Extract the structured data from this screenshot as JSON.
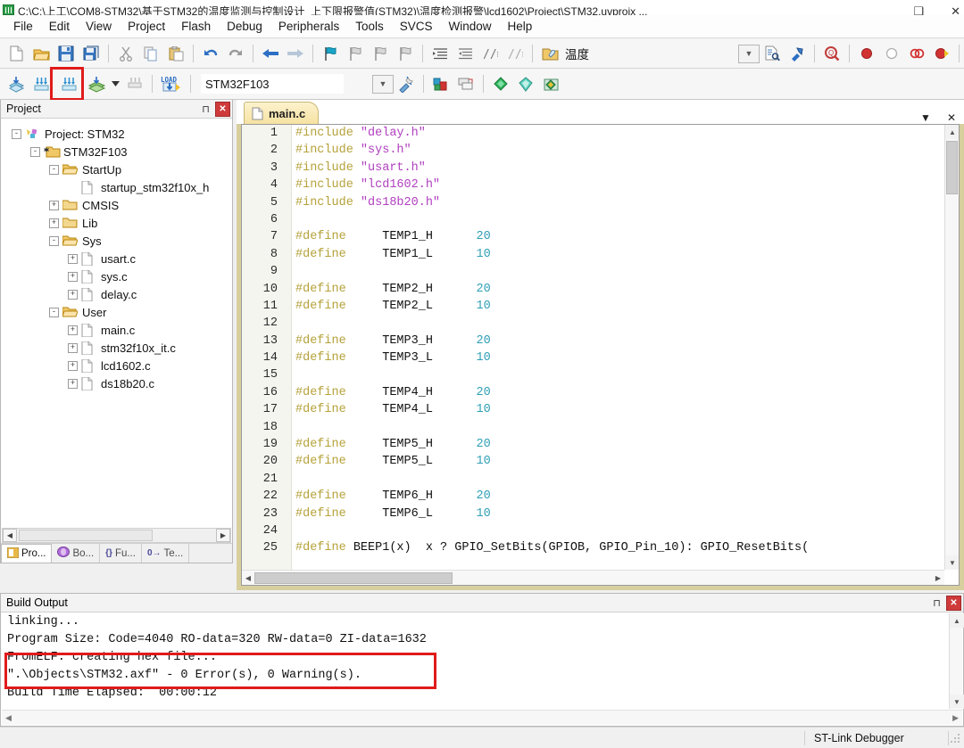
{
  "window": {
    "title": "C:\\C:\\上工\\COM8-STM32\\基于STM32的温度监测与控制设计_上下限报警值(STM32)\\温度检测报警\\lcd1602\\Project\\STM32.uvprojx ...",
    "minimize_label": "–",
    "maximize_label": "❑",
    "close_label": "✕",
    "app_icon": "keil-uvision-icon"
  },
  "menu": {
    "items": [
      "File",
      "Edit",
      "View",
      "Project",
      "Flash",
      "Debug",
      "Peripherals",
      "Tools",
      "SVCS",
      "Window",
      "Help"
    ]
  },
  "toolbar_main": {
    "buttons": [
      {
        "name": "new-file-icon",
        "glyph": "new"
      },
      {
        "name": "open-file-icon",
        "glyph": "open"
      },
      {
        "name": "save-icon",
        "glyph": "save"
      },
      {
        "name": "save-all-icon",
        "glyph": "saveall"
      },
      {
        "name": "cut-icon",
        "glyph": "cut"
      },
      {
        "name": "copy-icon",
        "glyph": "copy"
      },
      {
        "name": "paste-icon",
        "glyph": "paste"
      },
      {
        "name": "undo-icon",
        "glyph": "undo"
      },
      {
        "name": "redo-icon",
        "glyph": "redo"
      },
      {
        "name": "navigate-backward-icon",
        "glyph": "back"
      },
      {
        "name": "navigate-forward-icon",
        "glyph": "forward"
      },
      {
        "name": "insert-bookmark-icon",
        "glyph": "bm1"
      },
      {
        "name": "prev-bookmark-icon",
        "glyph": "bm2"
      },
      {
        "name": "next-bookmark-icon",
        "glyph": "bm3"
      },
      {
        "name": "clear-bookmarks-icon",
        "glyph": "bm4"
      },
      {
        "name": "indent-icon",
        "glyph": "indent"
      },
      {
        "name": "outdent-icon",
        "glyph": "outdent"
      },
      {
        "name": "comment-icon",
        "glyph": "comment"
      },
      {
        "name": "uncomment-icon",
        "glyph": "uncomment"
      },
      {
        "name": "configure-target-icon",
        "glyph": "folderwiz"
      }
    ],
    "search_text": "温度",
    "right_buttons": [
      {
        "name": "find-dropdown-icon",
        "glyph": "combo"
      },
      {
        "name": "find-in-files-icon",
        "glyph": "findfiles"
      },
      {
        "name": "find-tool-icon",
        "glyph": "findtool"
      },
      {
        "name": "incremental-find-icon",
        "glyph": "magnify"
      },
      {
        "name": "insert-breakpoint-icon",
        "glyph": "bp-red"
      },
      {
        "name": "kill-breakpoint-icon",
        "glyph": "bp-hollow"
      },
      {
        "name": "disable-breakpoint-icon",
        "glyph": "bp-disable"
      },
      {
        "name": "kill-all-breakpoints-icon",
        "glyph": "bp-killall"
      }
    ]
  },
  "toolbar_build": {
    "buttons": [
      {
        "name": "translate-icon",
        "glyph": "translate"
      },
      {
        "name": "build-icon",
        "glyph": "build"
      },
      {
        "name": "rebuild-icon",
        "glyph": "rebuild"
      },
      {
        "name": "batch-build-icon",
        "glyph": "batchbuild"
      },
      {
        "name": "batch-build-dropdown-icon",
        "glyph": "caret"
      },
      {
        "name": "stop-build-icon",
        "glyph": "stopbuild"
      },
      {
        "name": "download-icon",
        "glyph": "load"
      }
    ],
    "target_value": "STM32F103",
    "target_dropdown_icon": "chevron-down-icon",
    "after_buttons": [
      {
        "name": "target-options-icon",
        "glyph": "wand"
      },
      {
        "name": "manage-project-items-icon",
        "glyph": "manage"
      },
      {
        "name": "multi-project-icon",
        "glyph": "multiproj"
      },
      {
        "name": "pack-installer-icon",
        "glyph": "pack-green"
      },
      {
        "name": "manage-run-time-icon",
        "glyph": "pack-cyan"
      },
      {
        "name": "select-software-packs-icon",
        "glyph": "pack-multi"
      }
    ],
    "highlight_color": "#e01b1b"
  },
  "project_panel": {
    "title": "Project",
    "pin_icon": "pin-icon",
    "close_icon": "close-icon",
    "tree": [
      {
        "label": "Project: STM32",
        "depth": 0,
        "expander": "-",
        "icon": "project-icon"
      },
      {
        "label": "STM32F103",
        "depth": 1,
        "expander": "-",
        "icon": "target-icon"
      },
      {
        "label": "StartUp",
        "depth": 2,
        "expander": "-",
        "icon": "folder-open-icon"
      },
      {
        "label": "startup_stm32f10x_h",
        "depth": 3,
        "expander": "",
        "icon": "file-icon"
      },
      {
        "label": "CMSIS",
        "depth": 2,
        "expander": "+",
        "icon": "folder-icon"
      },
      {
        "label": "Lib",
        "depth": 2,
        "expander": "+",
        "icon": "folder-icon"
      },
      {
        "label": "Sys",
        "depth": 2,
        "expander": "-",
        "icon": "folder-open-icon"
      },
      {
        "label": "usart.c",
        "depth": 3,
        "expander": "+",
        "icon": "file-icon"
      },
      {
        "label": "sys.c",
        "depth": 3,
        "expander": "+",
        "icon": "file-icon"
      },
      {
        "label": "delay.c",
        "depth": 3,
        "expander": "+",
        "icon": "file-icon"
      },
      {
        "label": "User",
        "depth": 2,
        "expander": "-",
        "icon": "folder-open-icon"
      },
      {
        "label": "main.c",
        "depth": 3,
        "expander": "+",
        "icon": "file-icon"
      },
      {
        "label": "stm32f10x_it.c",
        "depth": 3,
        "expander": "+",
        "icon": "file-icon"
      },
      {
        "label": "lcd1602.c",
        "depth": 3,
        "expander": "+",
        "icon": "file-icon"
      },
      {
        "label": "ds18b20.c",
        "depth": 3,
        "expander": "+",
        "icon": "file-icon"
      }
    ],
    "tabs": [
      {
        "label": "Pro...",
        "icon": "project-tab-icon",
        "active": true
      },
      {
        "label": "Bo...",
        "icon": "books-tab-icon",
        "active": false
      },
      {
        "label": "Fu...",
        "icon": "functions-tab-icon",
        "prefix": "{}",
        "active": false
      },
      {
        "label": "Te...",
        "icon": "templates-tab-icon",
        "prefix": "0→",
        "active": false
      }
    ],
    "scroll_left_icon": "arrow-left-icon",
    "scroll_right_icon": "arrow-right-icon"
  },
  "editor": {
    "tab_label": "main.c",
    "tab_icon": "c-file-icon",
    "tab_list_icon": "chevron-down-icon",
    "tab_close_icon": "close-icon",
    "lines": [
      {
        "n": "1",
        "tokens": [
          {
            "t": "#include ",
            "c": "kw"
          },
          {
            "t": "\"delay.h\"",
            "c": "str"
          }
        ]
      },
      {
        "n": "2",
        "tokens": [
          {
            "t": "#include ",
            "c": "kw"
          },
          {
            "t": "\"sys.h\"",
            "c": "str"
          }
        ]
      },
      {
        "n": "3",
        "tokens": [
          {
            "t": "#include ",
            "c": "kw"
          },
          {
            "t": "\"usart.h\"",
            "c": "str"
          }
        ]
      },
      {
        "n": "4",
        "tokens": [
          {
            "t": "#include ",
            "c": "kw"
          },
          {
            "t": "\"lcd1602.h\"",
            "c": "str"
          }
        ]
      },
      {
        "n": "5",
        "tokens": [
          {
            "t": "#include ",
            "c": "kw"
          },
          {
            "t": "\"ds18b20.h\"",
            "c": "str"
          }
        ]
      },
      {
        "n": "6",
        "tokens": []
      },
      {
        "n": "7",
        "tokens": [
          {
            "t": "#define",
            "c": "kw"
          },
          {
            "t": "     TEMP1_H",
            "c": "plain"
          },
          {
            "t": "      20",
            "c": "num"
          }
        ]
      },
      {
        "n": "8",
        "tokens": [
          {
            "t": "#define",
            "c": "kw"
          },
          {
            "t": "     TEMP1_L",
            "c": "plain"
          },
          {
            "t": "      10",
            "c": "num"
          }
        ]
      },
      {
        "n": "9",
        "tokens": []
      },
      {
        "n": "10",
        "tokens": [
          {
            "t": "#define",
            "c": "kw"
          },
          {
            "t": "     TEMP2_H",
            "c": "plain"
          },
          {
            "t": "      20",
            "c": "num"
          }
        ]
      },
      {
        "n": "11",
        "tokens": [
          {
            "t": "#define",
            "c": "kw"
          },
          {
            "t": "     TEMP2_L",
            "c": "plain"
          },
          {
            "t": "      10",
            "c": "num"
          }
        ]
      },
      {
        "n": "12",
        "tokens": []
      },
      {
        "n": "13",
        "tokens": [
          {
            "t": "#define",
            "c": "kw"
          },
          {
            "t": "     TEMP3_H",
            "c": "plain"
          },
          {
            "t": "      20",
            "c": "num"
          }
        ]
      },
      {
        "n": "14",
        "tokens": [
          {
            "t": "#define",
            "c": "kw"
          },
          {
            "t": "     TEMP3_L",
            "c": "plain"
          },
          {
            "t": "      10",
            "c": "num"
          }
        ]
      },
      {
        "n": "15",
        "tokens": []
      },
      {
        "n": "16",
        "tokens": [
          {
            "t": "#define",
            "c": "kw"
          },
          {
            "t": "     TEMP4_H",
            "c": "plain"
          },
          {
            "t": "      20",
            "c": "num"
          }
        ]
      },
      {
        "n": "17",
        "tokens": [
          {
            "t": "#define",
            "c": "kw"
          },
          {
            "t": "     TEMP4_L",
            "c": "plain"
          },
          {
            "t": "      10",
            "c": "num"
          }
        ]
      },
      {
        "n": "18",
        "tokens": []
      },
      {
        "n": "19",
        "tokens": [
          {
            "t": "#define",
            "c": "kw"
          },
          {
            "t": "     TEMP5_H",
            "c": "plain"
          },
          {
            "t": "      20",
            "c": "num"
          }
        ]
      },
      {
        "n": "20",
        "tokens": [
          {
            "t": "#define",
            "c": "kw"
          },
          {
            "t": "     TEMP5_L",
            "c": "plain"
          },
          {
            "t": "      10",
            "c": "num"
          }
        ]
      },
      {
        "n": "21",
        "tokens": []
      },
      {
        "n": "22",
        "tokens": [
          {
            "t": "#define",
            "c": "kw"
          },
          {
            "t": "     TEMP6_H",
            "c": "plain"
          },
          {
            "t": "      20",
            "c": "num"
          }
        ]
      },
      {
        "n": "23",
        "tokens": [
          {
            "t": "#define",
            "c": "kw"
          },
          {
            "t": "     TEMP6_L",
            "c": "plain"
          },
          {
            "t": "      10",
            "c": "num"
          }
        ]
      },
      {
        "n": "24",
        "tokens": []
      },
      {
        "n": "25",
        "tokens": [
          {
            "t": "#define",
            "c": "kw"
          },
          {
            "t": " BEEP1(x)  x ? GPIO_SetBits(GPIOB, GPIO_Pin_10): GPIO_ResetBits(",
            "c": "plain"
          }
        ]
      }
    ]
  },
  "build_output": {
    "title": "Build Output",
    "pin_icon": "pin-icon",
    "close_icon": "close-icon",
    "lines": [
      {
        "text": "linking...",
        "highlighted": false
      },
      {
        "text": "Program Size: Code=4040 RO-data=320 RW-data=0 ZI-data=1632",
        "highlighted": false
      },
      {
        "text": "FromELF: creating hex file...",
        "highlighted": true
      },
      {
        "text": "\".\\Objects\\STM32.axf\" - 0 Error(s), 0 Warning(s).",
        "highlighted": true
      },
      {
        "text": "Build Time Elapsed:  00:00:12",
        "highlighted": false
      }
    ],
    "highlight_color": "#e01b1b",
    "scroll_up_icon": "chevron-up-icon",
    "scroll_down_icon": "chevron-down-icon",
    "scroll_left_icon": "chevron-left-icon",
    "scroll_right_icon": "chevron-right-icon"
  },
  "statusbar": {
    "debugger": "ST-Link Debugger",
    "grip_icon": "resize-grip-icon"
  }
}
